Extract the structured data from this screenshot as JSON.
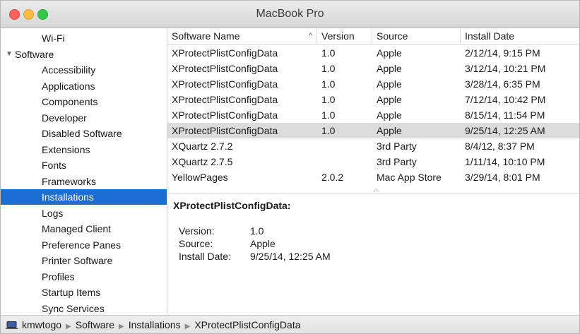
{
  "window": {
    "title": "MacBook Pro"
  },
  "sidebar": {
    "top_item": "Wi-Fi",
    "group": {
      "label": "Software",
      "expanded": true
    },
    "items": [
      "Accessibility",
      "Applications",
      "Components",
      "Developer",
      "Disabled Software",
      "Extensions",
      "Fonts",
      "Frameworks",
      "Installations",
      "Logs",
      "Managed Client",
      "Preference Panes",
      "Printer Software",
      "Profiles",
      "Startup Items",
      "Sync Services"
    ],
    "selected": "Installations"
  },
  "table": {
    "columns": [
      "Software Name",
      "Version",
      "Source",
      "Install Date"
    ],
    "sort_indicator": "^",
    "rows": [
      [
        "XProtectPlistConfigData",
        "1.0",
        "Apple",
        "2/12/14, 9:15 PM"
      ],
      [
        "XProtectPlistConfigData",
        "1.0",
        "Apple",
        "3/12/14, 10:21 PM"
      ],
      [
        "XProtectPlistConfigData",
        "1.0",
        "Apple",
        "3/28/14, 6:35 PM"
      ],
      [
        "XProtectPlistConfigData",
        "1.0",
        "Apple",
        "7/12/14, 10:42 PM"
      ],
      [
        "XProtectPlistConfigData",
        "1.0",
        "Apple",
        "8/15/14, 11:54 PM"
      ],
      [
        "XProtectPlistConfigData",
        "1.0",
        "Apple",
        "9/25/14, 12:25 AM"
      ],
      [
        "XQuartz 2.7.2",
        "",
        "3rd Party",
        "8/4/12, 8:37 PM"
      ],
      [
        "XQuartz 2.7.5",
        "",
        "3rd Party",
        "1/11/14, 10:10 PM"
      ],
      [
        "YellowPages",
        "2.0.2",
        "Mac App Store",
        "3/29/14, 8:01 PM"
      ]
    ],
    "selected_row": 5
  },
  "detail": {
    "title": "XProtectPlistConfigData:",
    "fields": [
      {
        "label": "Version:",
        "value": "1.0"
      },
      {
        "label": "Source:",
        "value": "Apple"
      },
      {
        "label": "Install Date:",
        "value": "9/25/14, 12:25 AM"
      }
    ]
  },
  "pathbar": {
    "icon": "computer-icon",
    "crumbs": [
      "kmwtogo",
      "Software",
      "Installations",
      "XProtectPlistConfigData"
    ]
  },
  "colors": {
    "selection_blue": "#1b6fd4",
    "row_selected_gray": "#dcdcdc",
    "close": "#fc605c",
    "minimize": "#fdbc40",
    "zoom": "#34c84a"
  }
}
